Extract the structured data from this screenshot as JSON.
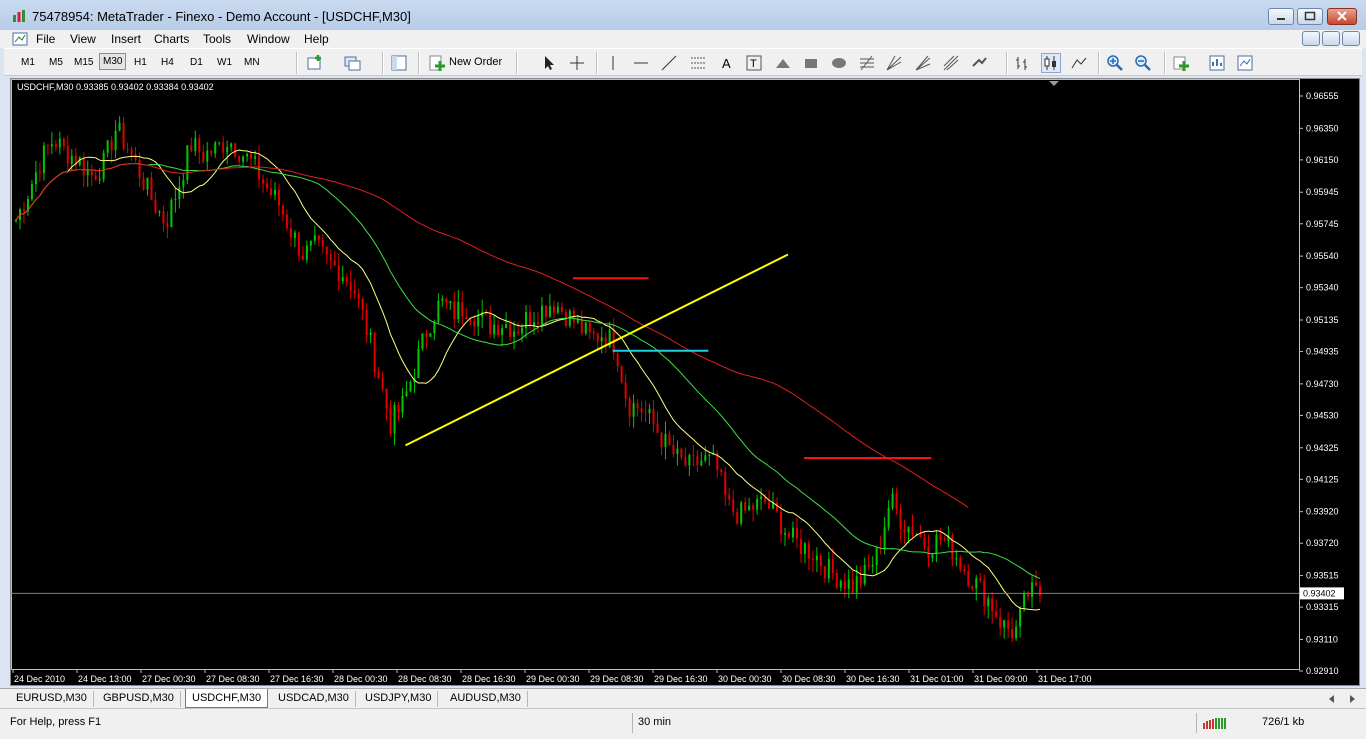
{
  "window": {
    "title": "75478954: MetaTrader - Finexo - Demo Account - [USDCHF,M30]"
  },
  "menu": [
    "File",
    "View",
    "Insert",
    "Charts",
    "Tools",
    "Window",
    "Help"
  ],
  "toolbar": {
    "timeframes": [
      "M1",
      "M5",
      "M15",
      "M30",
      "H1",
      "H4",
      "D1",
      "W1",
      "MN"
    ],
    "active_timeframe": "M30",
    "new_order_label": "New Order",
    "icons": [
      "new-chart-icon",
      "profiles-icon",
      "navigator-icon",
      "new-order-icon",
      "cursor-icon",
      "crosshair-icon",
      "vertical-line-icon",
      "horizontal-line-icon",
      "trendline-icon",
      "channel-icon",
      "text-icon",
      "text-label-icon",
      "triangle-icon",
      "rectangle-icon",
      "ellipse-icon",
      "fibonacci-icon",
      "gann-fan-icon",
      "arrows-icon",
      "bar-chart-icon",
      "candlestick-icon",
      "line-chart-icon",
      "zoom-in-icon",
      "zoom-out-icon",
      "indicators-icon",
      "periods-icon",
      "templates-icon"
    ]
  },
  "chart": {
    "info_label": "USDCHF,M30  0.93385 0.93402 0.93384 0.93402",
    "current_price": "0.93402",
    "price_ticks": [
      "0.96555",
      "0.96350",
      "0.96150",
      "0.95945",
      "0.95745",
      "0.95540",
      "0.95340",
      "0.95135",
      "0.94935",
      "0.94730",
      "0.94530",
      "0.94325",
      "0.94125",
      "0.93920",
      "0.93720",
      "0.93515",
      "0.93315",
      "0.93110",
      "0.92910"
    ],
    "time_ticks": [
      "24 Dec 2010",
      "24 Dec 13:00",
      "27 Dec 00:30",
      "27 Dec 08:30",
      "27 Dec 16:30",
      "28 Dec 00:30",
      "28 Dec 08:30",
      "28 Dec 16:30",
      "29 Dec 00:30",
      "29 Dec 08:30",
      "29 Dec 16:30",
      "30 Dec 00:30",
      "30 Dec 08:30",
      "30 Dec 16:30",
      "31 Dec 01:00",
      "31 Dec 09:00",
      "31 Dec 17:00"
    ],
    "colors": {
      "bull": "#00c800",
      "bear": "#e00000",
      "ma_fast": "#ffff80",
      "ma_mid": "#40e040",
      "ma_slow": "#e02020",
      "trendline": "#ffff00",
      "resistance": "#ff1010",
      "support": "#20d0e0"
    }
  },
  "chart_data": {
    "type": "candlestick",
    "symbol": "USDCHF",
    "timeframe": "M30",
    "ylim": [
      0.9291,
      0.9665
    ],
    "closes": [
      0.9577,
      0.9595,
      0.9615,
      0.9628,
      0.962,
      0.9615,
      0.9605,
      0.9612,
      0.9635,
      0.9622,
      0.9605,
      0.9588,
      0.9575,
      0.9598,
      0.9625,
      0.9618,
      0.9622,
      0.9628,
      0.962,
      0.9612,
      0.9598,
      0.9588,
      0.957,
      0.9555,
      0.956,
      0.955,
      0.9545,
      0.9535,
      0.951,
      0.948,
      0.9448,
      0.946,
      0.9485,
      0.951,
      0.9525,
      0.9518,
      0.9522,
      0.9515,
      0.951,
      0.9512,
      0.9508,
      0.9515,
      0.952,
      0.9525,
      0.9518,
      0.951,
      0.9502,
      0.9505,
      0.9498,
      0.946,
      0.9458,
      0.9448,
      0.9435,
      0.9425,
      0.942,
      0.9425,
      0.9422,
      0.9395,
      0.939,
      0.9395,
      0.9398,
      0.9388,
      0.9375,
      0.937,
      0.9365,
      0.9355,
      0.935,
      0.9345,
      0.9352,
      0.9365,
      0.94,
      0.9385,
      0.938,
      0.937,
      0.9375,
      0.9368,
      0.9355,
      0.9345,
      0.9335,
      0.932,
      0.9315,
      0.934,
      0.934
    ],
    "indicators": [
      "moving-average-yellow",
      "moving-average-green",
      "moving-average-red"
    ],
    "objects": [
      "yellow-trendline",
      "red-resistance-line-1",
      "red-resistance-line-2",
      "cyan-support-line"
    ]
  },
  "bottom_tabs": [
    "EURUSD,M30",
    "GBPUSD,M30",
    "USDCHF,M30",
    "USDCAD,M30",
    "USDJPY,M30",
    "AUDUSD,M30"
  ],
  "active_tab": "USDCHF,M30",
  "status": {
    "help": "For Help, press F1",
    "period": "30 min",
    "traffic": "726/1 kb"
  }
}
